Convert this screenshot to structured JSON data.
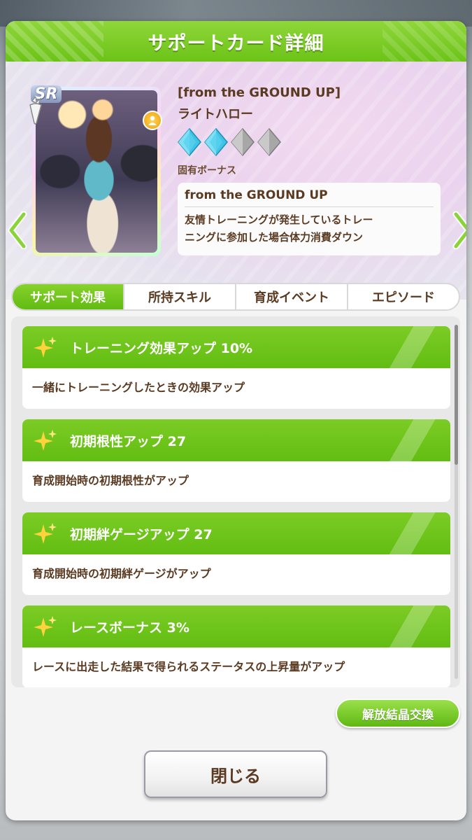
{
  "modal": {
    "title": "サポートカード詳細"
  },
  "card": {
    "rarity": "SR",
    "title": "[from the GROUND UP]",
    "character_name": "ライトハロー",
    "limit_break": 2,
    "limit_break_max": 4,
    "unique_bonus_label": "固有ボーナス",
    "unique_bonus_name": "from the GROUND UP",
    "unique_bonus_desc_line1": "友情トレーニングが発生しているトレー",
    "unique_bonus_desc_line2": "ニングに参加した場合体力消費ダウン"
  },
  "tabs": [
    {
      "label": "サポート効果",
      "active": true
    },
    {
      "label": "所持スキル",
      "active": false
    },
    {
      "label": "育成イベント",
      "active": false
    },
    {
      "label": "エピソード",
      "active": false
    }
  ],
  "effects": [
    {
      "title": "トレーニング効果アップ 10%",
      "desc": "一緒にトレーニングしたときの効果アップ"
    },
    {
      "title": "初期根性アップ 27",
      "desc": "育成開始時の初期根性がアップ"
    },
    {
      "title": "初期絆ゲージアップ 27",
      "desc": "育成開始時の初期絆ゲージがアップ"
    },
    {
      "title": "レースボーナス 3%",
      "desc": "レースに出走した結果で得られるステータスの上昇量がアップ"
    }
  ],
  "buttons": {
    "exchange": "解放結晶交換",
    "close": "閉じる"
  },
  "colors": {
    "accent_green": "#6cc317",
    "text_brown": "#5b3a22",
    "gem_active": "#4ec9e8",
    "gem_inactive": "#a9a9a9"
  }
}
